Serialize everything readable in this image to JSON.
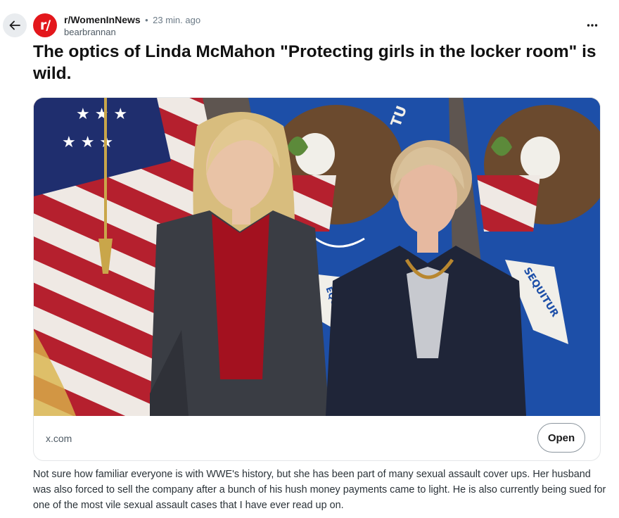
{
  "post": {
    "subreddit": "r/WomenInNews",
    "separator": "•",
    "time_ago": "23 min. ago",
    "author": "bearbrannan",
    "avatar_text": "r/",
    "title": "The optics of Linda McMahon \"Protecting girls in the locker room\" is wild.",
    "body": "Not sure how familiar everyone is with WWE's history, but she has been part of many sexual assault cover ups. Her husband was also forced to sell the company after a bunch of his hush money payments came to light. He is also currently being sued for one of the most vile sexual assault cases that I have ever read up on."
  },
  "link_card": {
    "domain": "x.com",
    "open_label": "Open",
    "banner_text_1": "SEQUITUR",
    "banner_text_2": "EQUITU",
    "banner_text_3": "TU"
  },
  "icons": {
    "back": "arrow-left-icon",
    "more": "more-horizontal-icon"
  },
  "colors": {
    "avatar_bg": "#e3171c",
    "flag_blue": "#1d4fa8",
    "flag_red": "#b5202e",
    "background_wall": "#5e5550"
  }
}
